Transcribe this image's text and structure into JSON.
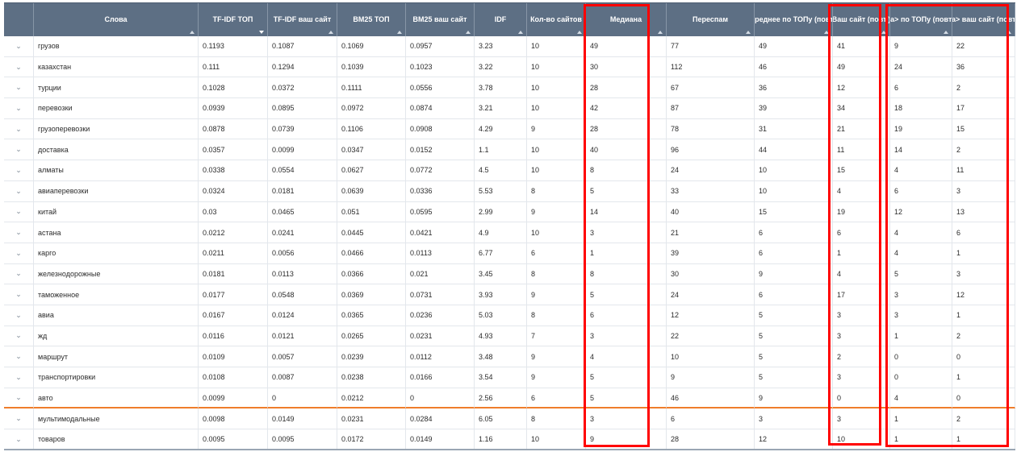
{
  "columns": [
    {
      "label": "",
      "sort": ""
    },
    {
      "label": "Слова",
      "sort": "asc"
    },
    {
      "label": "TF-IDF ТОП",
      "sort": "desc"
    },
    {
      "label": "TF-IDF ваш сайт",
      "sort": "asc"
    },
    {
      "label": "BM25 ТОП",
      "sort": "asc"
    },
    {
      "label": "BM25 ваш сайт",
      "sort": "asc"
    },
    {
      "label": "IDF",
      "sort": "asc"
    },
    {
      "label": "Кол-во сайтов",
      "sort": "asc"
    },
    {
      "label": "Медиана",
      "sort": "asc"
    },
    {
      "label": "Переспам",
      "sort": "asc"
    },
    {
      "label": "Среднее по ТОПу (повт.)",
      "sort": "asc"
    },
    {
      "label": "Ваш сайт (повт.)",
      "sort": "asc"
    },
    {
      "label": "<a> по ТОПу (повт.)",
      "sort": "asc"
    },
    {
      "label": "<a> ваш сайт (повт.)",
      "sort": "asc"
    }
  ],
  "expand_glyph": "⌄",
  "rows": [
    [
      "грузов",
      "0.1193",
      "0.1087",
      "0.1069",
      "0.0957",
      "3.23",
      "10",
      "49",
      "77",
      "49",
      "41",
      "9",
      "22"
    ],
    [
      "казахстан",
      "0.111",
      "0.1294",
      "0.1039",
      "0.1023",
      "3.22",
      "10",
      "30",
      "112",
      "46",
      "49",
      "24",
      "36"
    ],
    [
      "турции",
      "0.1028",
      "0.0372",
      "0.1111",
      "0.0556",
      "3.78",
      "10",
      "28",
      "67",
      "36",
      "12",
      "6",
      "2"
    ],
    [
      "перевозки",
      "0.0939",
      "0.0895",
      "0.0972",
      "0.0874",
      "3.21",
      "10",
      "42",
      "87",
      "39",
      "34",
      "18",
      "17"
    ],
    [
      "грузоперевозки",
      "0.0878",
      "0.0739",
      "0.1106",
      "0.0908",
      "4.29",
      "9",
      "28",
      "78",
      "31",
      "21",
      "19",
      "15"
    ],
    [
      "доставка",
      "0.0357",
      "0.0099",
      "0.0347",
      "0.0152",
      "1.1",
      "10",
      "40",
      "96",
      "44",
      "11",
      "14",
      "2"
    ],
    [
      "алматы",
      "0.0338",
      "0.0554",
      "0.0627",
      "0.0772",
      "4.5",
      "10",
      "8",
      "24",
      "10",
      "15",
      "4",
      "11"
    ],
    [
      "авиаперевозки",
      "0.0324",
      "0.0181",
      "0.0639",
      "0.0336",
      "5.53",
      "8",
      "5",
      "33",
      "10",
      "4",
      "6",
      "3"
    ],
    [
      "китай",
      "0.03",
      "0.0465",
      "0.051",
      "0.0595",
      "2.99",
      "9",
      "14",
      "40",
      "15",
      "19",
      "12",
      "13"
    ],
    [
      "астана",
      "0.0212",
      "0.0241",
      "0.0445",
      "0.0421",
      "4.9",
      "10",
      "3",
      "21",
      "6",
      "6",
      "4",
      "6"
    ],
    [
      "карго",
      "0.0211",
      "0.0056",
      "0.0466",
      "0.0113",
      "6.77",
      "6",
      "1",
      "39",
      "6",
      "1",
      "4",
      "1"
    ],
    [
      "железнодорожные",
      "0.0181",
      "0.0113",
      "0.0366",
      "0.021",
      "3.45",
      "8",
      "8",
      "30",
      "9",
      "4",
      "5",
      "3"
    ],
    [
      "таможенное",
      "0.0177",
      "0.0548",
      "0.0369",
      "0.0731",
      "3.93",
      "9",
      "5",
      "24",
      "6",
      "17",
      "3",
      "12"
    ],
    [
      "авиа",
      "0.0167",
      "0.0124",
      "0.0365",
      "0.0236",
      "5.03",
      "8",
      "6",
      "12",
      "5",
      "3",
      "3",
      "1"
    ],
    [
      "жд",
      "0.0116",
      "0.0121",
      "0.0265",
      "0.0231",
      "4.93",
      "7",
      "3",
      "22",
      "5",
      "3",
      "1",
      "2"
    ],
    [
      "маршрут",
      "0.0109",
      "0.0057",
      "0.0239",
      "0.0112",
      "3.48",
      "9",
      "4",
      "10",
      "5",
      "2",
      "0",
      "0"
    ],
    [
      "транспортировки",
      "0.0108",
      "0.0087",
      "0.0238",
      "0.0166",
      "3.54",
      "9",
      "5",
      "9",
      "5",
      "3",
      "0",
      "1"
    ],
    [
      "авто",
      "0.0099",
      "0",
      "0.0212",
      "0",
      "2.56",
      "6",
      "5",
      "46",
      "9",
      "0",
      "4",
      "0"
    ],
    [
      "мультимодальные",
      "0.0098",
      "0.0149",
      "0.0231",
      "0.0284",
      "6.05",
      "8",
      "3",
      "6",
      "3",
      "3",
      "1",
      "2"
    ],
    [
      "товаров",
      "0.0095",
      "0.0095",
      "0.0172",
      "0.0149",
      "1.16",
      "10",
      "9",
      "28",
      "12",
      "10",
      "1",
      "1"
    ]
  ],
  "marked_row": 17,
  "highlight_color": "#ff0000"
}
